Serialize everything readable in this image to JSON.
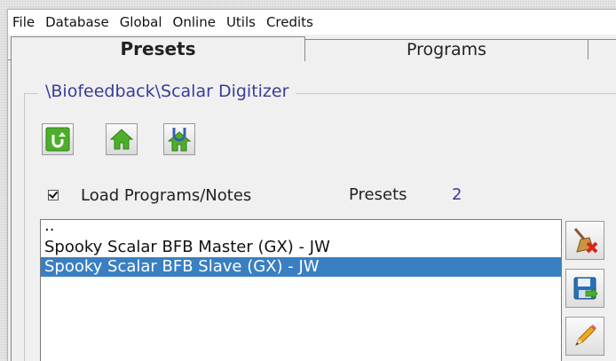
{
  "menu": {
    "items": [
      "File",
      "Database",
      "Global",
      "Online",
      "Utils",
      "Credits"
    ]
  },
  "tabs": {
    "presets": "Presets",
    "programs": "Programs"
  },
  "group": {
    "caption": "\\Biofeedback\\Scalar Digitizer"
  },
  "toolbar": {
    "icons": [
      "refresh-icon",
      "home-icon",
      "home-up-icon"
    ]
  },
  "options": {
    "load_programs_label": "Load Programs/Notes",
    "load_programs_checked": true,
    "presets_label": "Presets",
    "presets_count": "2"
  },
  "list": {
    "items": [
      {
        "label": "..",
        "selected": false
      },
      {
        "label": "Spooky Scalar BFB Master (GX) - JW",
        "selected": false
      },
      {
        "label": "Spooky Scalar BFB Slave (GX) - JW",
        "selected": true
      }
    ]
  },
  "side_buttons": {
    "icons": [
      "delete-broom-icon",
      "save-icon",
      "edit-pencil-icon"
    ]
  },
  "colors": {
    "selection": "#3a7fc1",
    "caption_text": "#3b3b9a",
    "icon_green": "#4caf2a"
  }
}
